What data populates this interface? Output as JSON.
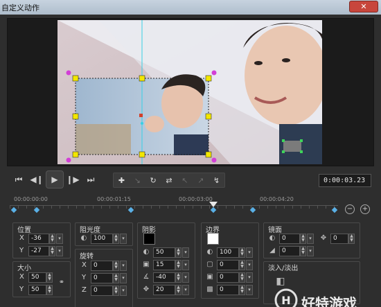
{
  "window": {
    "title": "自定义动作",
    "close_glyph": "✕"
  },
  "playback": {
    "timecode": "0:00:03.23",
    "icons": [
      "skip-start-icon",
      "prev-frame-icon",
      "play-icon",
      "next-frame-icon",
      "skip-end-icon"
    ]
  },
  "toolbar": {
    "tools": [
      "add-keyframe-icon",
      "remove-keyframe-icon",
      "reverse-keyframe-icon",
      "swap-keyframe-icon",
      "move-left-icon",
      "move-right-icon",
      "goto-keyframe-icon"
    ]
  },
  "timeline": {
    "marks": [
      "00:00:00:00",
      "00:00:01:15",
      "00:00:03:00",
      "00:00:04:20"
    ]
  },
  "position": {
    "label": "位置",
    "x_label": "X",
    "x": "-36",
    "y_label": "Y",
    "y": "-27"
  },
  "size": {
    "label": "大小",
    "x_label": "X",
    "x": "50",
    "y_label": "Y",
    "y": "50"
  },
  "opacity": {
    "label": "阻光度",
    "value": "100"
  },
  "rotation": {
    "label": "旋转",
    "x_label": "X",
    "x": "0",
    "y_label": "Y",
    "y": "0",
    "z_label": "Z",
    "z": "0"
  },
  "shadow": {
    "label": "阴影",
    "color": "#000000",
    "opacity": "50",
    "blur": "15",
    "angle": "-40",
    "distance": "20"
  },
  "border": {
    "label": "边界",
    "color": "#ffffff",
    "opacity": "100",
    "v1": "0",
    "v2": "0",
    "v3": "0"
  },
  "mirror": {
    "label": "镜面",
    "v1": "0",
    "v2": "0",
    "v3": "0"
  },
  "fade": {
    "label": "淡入/淡出"
  },
  "watermark": {
    "text": "好特游戏"
  }
}
